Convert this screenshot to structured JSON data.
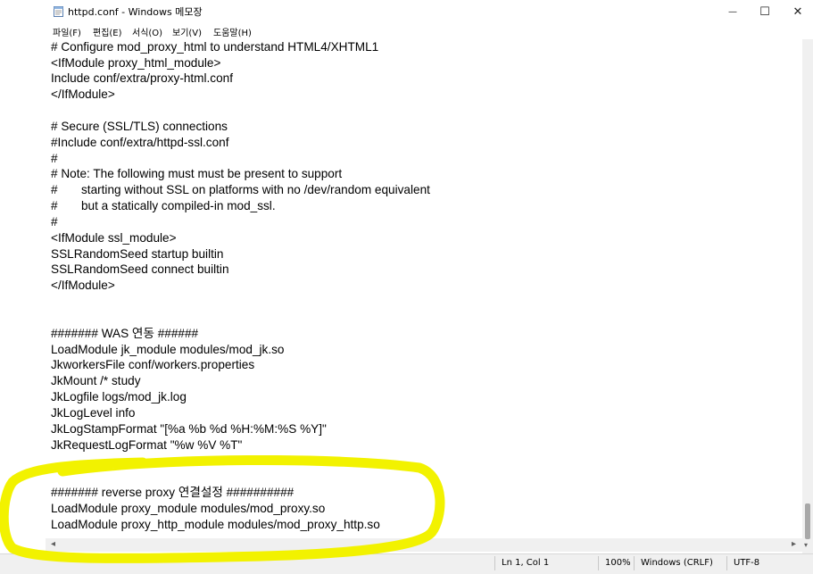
{
  "window": {
    "title": "httpd.conf - Windows 메모장",
    "minimize": "—",
    "maximize": "☐",
    "close": "✕"
  },
  "menu": [
    "파일(F)",
    "편집(E)",
    "서식(O)",
    "보기(V)",
    "도움말(H)"
  ],
  "lines": [
    "# Configure mod_proxy_html to understand HTML4/XHTML1",
    "<IfModule proxy_html_module>",
    "Include conf/extra/proxy-html.conf",
    "</IfModule>",
    "",
    "# Secure (SSL/TLS) connections",
    "#Include conf/extra/httpd-ssl.conf",
    "#",
    "# Note: The following must must be present to support",
    "#       starting without SSL on platforms with no /dev/random equivalent",
    "#       but a statically compiled-in mod_ssl.",
    "#",
    "<IfModule ssl_module>",
    "SSLRandomSeed startup builtin",
    "SSLRandomSeed connect builtin",
    "</IfModule>",
    "",
    "",
    "####### WAS 연동 ######",
    "LoadModule jk_module modules/mod_jk.so",
    "JkworkersFile conf/workers.properties",
    "JkMount /* study",
    "JkLogfile logs/mod_jk.log",
    "JkLogLevel info",
    "JkLogStampFormat \"[%a %b %d %H:%M:%S %Y]\"",
    "JkRequestLogFormat \"%w %V %T\"",
    "",
    "",
    "####### reverse proxy 연결설정 ##########",
    "LoadModule proxy_module modules/mod_proxy.so",
    "LoadModule proxy_http_module modules/mod_proxy_http.so"
  ],
  "status": {
    "position": "Ln 1, Col 1",
    "zoom": "100%",
    "line_ending": "Windows (CRLF)",
    "encoding": "UTF-8"
  },
  "icons": {
    "app": "notepad-icon",
    "scroll_left": "◂",
    "scroll_right": "▸",
    "scroll_down": "▾"
  },
  "colors": {
    "highlight": "#f2f200"
  }
}
